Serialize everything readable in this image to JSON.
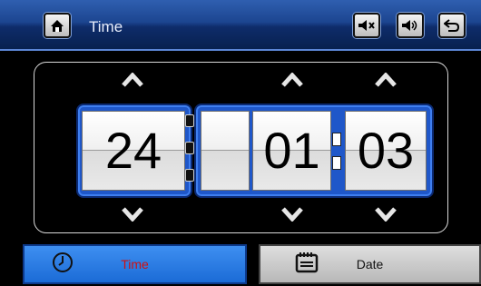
{
  "header": {
    "title": "Time",
    "home_icon": "home-icon",
    "mute_icon": "mute-icon",
    "volume_icon": "volume-icon",
    "back_icon": "back-icon"
  },
  "clock": {
    "hour": "24",
    "blank": "",
    "minute": "01",
    "second": "03"
  },
  "tabs": {
    "time_label": "Time",
    "date_label": "Date",
    "active": "Time"
  },
  "colors": {
    "header": "#1c4590",
    "active_tab": "#2a7ce6",
    "active_label": "#d01010",
    "frame": "#1f57c9"
  }
}
